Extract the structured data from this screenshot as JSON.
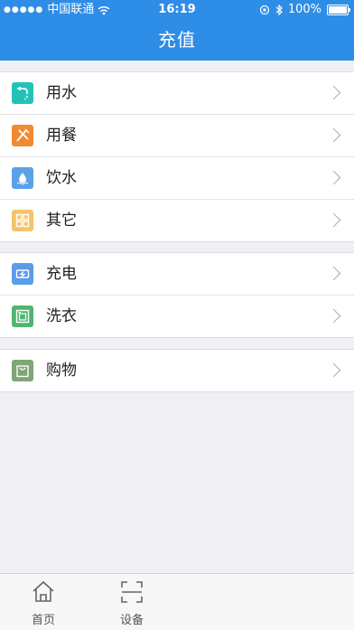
{
  "status_bar": {
    "carrier": "中国联通",
    "time": "16:19",
    "battery": "100%"
  },
  "header": {
    "title": "充值"
  },
  "groups": [
    {
      "items": [
        {
          "label": "用水",
          "icon": "water-tap-icon",
          "color": "#23c2b8"
        },
        {
          "label": "用餐",
          "icon": "utensils-icon",
          "color": "#f08a31"
        },
        {
          "label": "饮水",
          "icon": "water-drop-icon",
          "color": "#5aa2e8"
        },
        {
          "label": "其它",
          "icon": "grid-icon",
          "color": "#f4c36c"
        }
      ]
    },
    {
      "items": [
        {
          "label": "充电",
          "icon": "battery-charge-icon",
          "color": "#5a9bea"
        },
        {
          "label": "洗衣",
          "icon": "washing-machine-icon",
          "color": "#4fb66f"
        }
      ]
    },
    {
      "items": [
        {
          "label": "购物",
          "icon": "shopping-bag-icon",
          "color": "#7fa675"
        }
      ]
    }
  ],
  "tabbar": {
    "tabs": [
      {
        "label": "首页",
        "icon": "home-icon"
      },
      {
        "label": "设备",
        "icon": "scan-icon"
      }
    ]
  }
}
